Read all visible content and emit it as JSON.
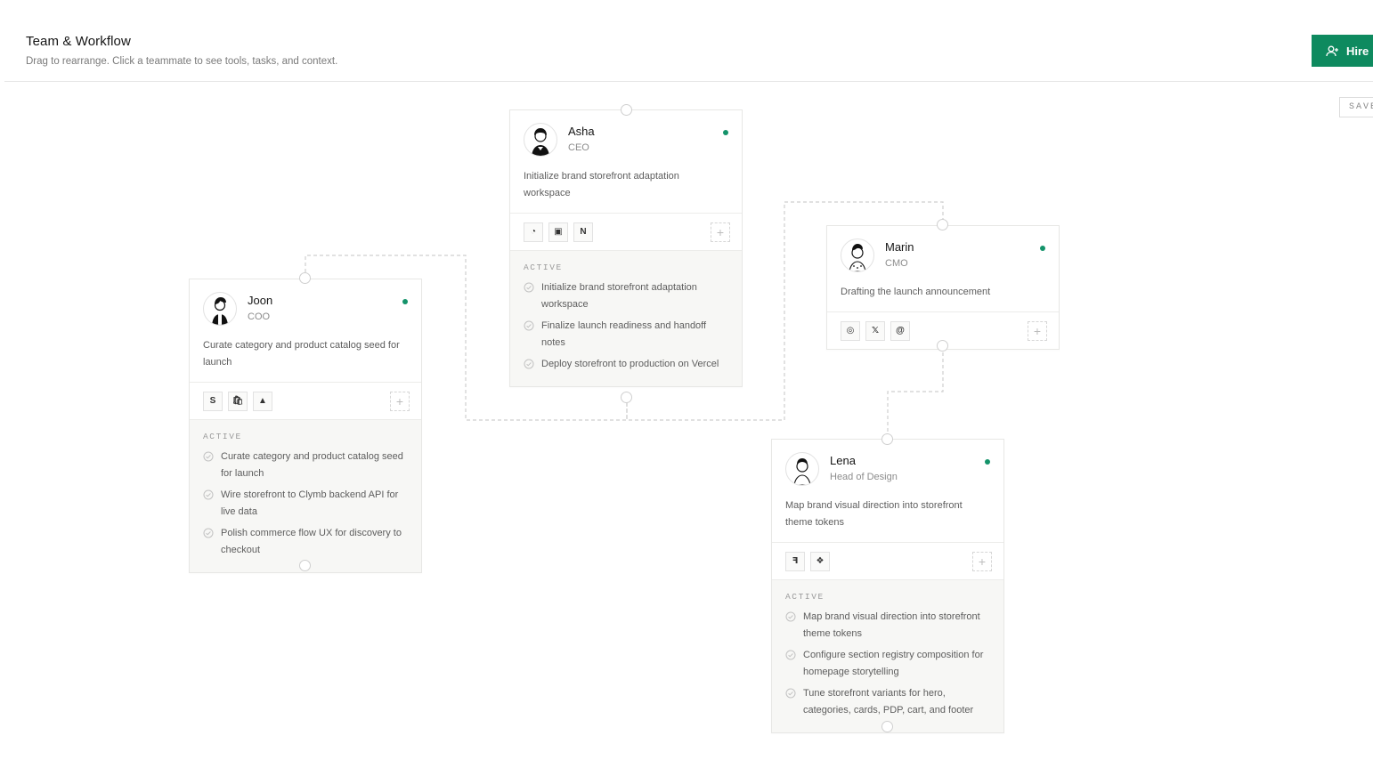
{
  "header": {
    "title": "Team & Workflow",
    "subtitle": "Drag to rearrange. Click a teammate to see tools, tasks, and context.",
    "hire_label": "Hire",
    "save_label": "SAVE"
  },
  "colors": {
    "accent": "#0e8a5f",
    "status_online": "#14936a"
  },
  "active_label": "ACTIVE",
  "cards": {
    "asha": {
      "name": "Asha",
      "role": "CEO",
      "task": "Initialize brand storefront adaptation workspace",
      "tools": [
        "linear-icon",
        "calendar-icon",
        "notion-icon"
      ],
      "tool_glyphs": [
        "◔",
        "▣",
        "N"
      ],
      "active": [
        "Initialize brand storefront adaptation workspace",
        "Finalize launch readiness and handoff notes",
        "Deploy storefront to production on Vercel"
      ]
    },
    "marin": {
      "name": "Marin",
      "role": "CMO",
      "task": "Drafting the launch announcement",
      "tools": [
        "instagram-icon",
        "x-icon",
        "threads-icon"
      ],
      "tool_glyphs": [
        "◎",
        "𝕏",
        "@"
      ]
    },
    "joon": {
      "name": "Joon",
      "role": "COO",
      "task": "Curate category and product catalog seed for launch",
      "tools": [
        "stripe-icon",
        "shopify-icon",
        "google-drive-icon"
      ],
      "tool_glyphs": [
        "S",
        "🛍",
        "▲"
      ],
      "active": [
        "Curate category and product catalog seed for launch",
        "Wire storefront to Clymb backend API for live data",
        "Polish commerce flow UX for discovery to checkout"
      ]
    },
    "lena": {
      "name": "Lena",
      "role": "Head of Design",
      "task": "Map brand visual direction into storefront theme tokens",
      "tools": [
        "figma-icon",
        "dropbox-icon"
      ],
      "tool_glyphs": [
        "ꟻ",
        "❖"
      ],
      "active": [
        "Map brand visual direction into storefront theme tokens",
        "Configure section registry composition for homepage storytelling",
        "Tune storefront variants for hero, categories, cards, PDP, cart, and footer"
      ]
    }
  }
}
